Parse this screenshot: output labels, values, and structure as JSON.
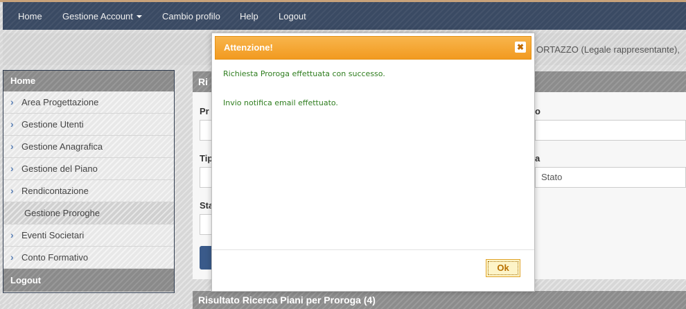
{
  "navbar": {
    "items": [
      "Home",
      "Gestione Account",
      "Cambio profilo",
      "Help",
      "Logout"
    ]
  },
  "user_info": "ORTAZZO (Legale rappresentante),",
  "sidebar": {
    "header": "Home",
    "items": [
      {
        "label": "Area Progettazione",
        "icon": "chevron-right-icon"
      },
      {
        "label": "Gestione Utenti",
        "icon": "chevron-right-icon"
      },
      {
        "label": "Gestione Anagrafica",
        "icon": "chevron-right-icon"
      },
      {
        "label": "Gestione del Piano",
        "icon": "chevron-right-icon"
      },
      {
        "label": "Rendicontazione",
        "icon": "chevron-right-icon"
      },
      {
        "label": "Gestione Proroghe",
        "active": true
      },
      {
        "label": "Eventi Societari",
        "icon": "chevron-right-icon"
      },
      {
        "label": "Conto Formativo",
        "icon": "chevron-right-icon"
      }
    ],
    "footer": "Logout"
  },
  "panel": {
    "header": "Ri",
    "labels": {
      "pr": "Pr",
      "o": "o",
      "tip": "Tip",
      "a": "a",
      "sta": "Sta"
    },
    "stato_value": "Stato",
    "results_header": "Risultato Ricerca Piani per Proroga (4)"
  },
  "modal": {
    "title": "Attenzione!",
    "close_glyph": "✖",
    "messages": [
      "Richiesta Proroga effettuata con successo.",
      "Invio notifica email effettuato."
    ],
    "ok_label": "Ok"
  },
  "colors": {
    "navbar": "#3a4a63",
    "modal_title": "#f29a20",
    "message_text": "#2e7d1e"
  }
}
